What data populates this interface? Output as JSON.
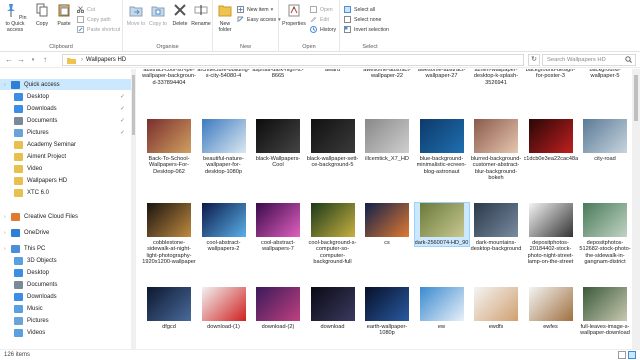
{
  "ribbon": {
    "clipboard": {
      "label": "Clipboard",
      "pin": "Pin to Quick access",
      "copy": "Copy",
      "paste": "Paste",
      "cut": "Cut",
      "copy_path": "Copy path",
      "paste_shortcut": "Paste shortcut"
    },
    "organise": {
      "label": "Organise",
      "move_to": "Move to",
      "copy_to": "Copy to",
      "delete": "Delete",
      "rename": "Rename"
    },
    "new": {
      "label": "New",
      "new_folder": "New folder",
      "new_item": "New item",
      "easy_access": "Easy access"
    },
    "open": {
      "label": "Open",
      "properties": "Properties",
      "open": "Open",
      "edit": "Edit",
      "history": "History"
    },
    "select": {
      "label": "Select",
      "select_all": "Select all",
      "select_none": "Select none",
      "invert": "Invert selection"
    }
  },
  "address": {
    "path_root_sep": "›",
    "folder": "Wallpapers HD",
    "search_placeholder": "Search Wallpapers HD"
  },
  "nav": [
    {
      "label": "Quick access",
      "icon": "star-icon",
      "color": "#2f7fd6"
    },
    {
      "label": "Desktop",
      "icon": "desktop-icon",
      "color": "#3a8ee6",
      "pinned": true
    },
    {
      "label": "Downloads",
      "icon": "download-icon",
      "color": "#3a8ee6",
      "pinned": true
    },
    {
      "label": "Documents",
      "icon": "documents-icon",
      "color": "#7a8a99",
      "pinned": true
    },
    {
      "label": "Pictures",
      "icon": "pictures-icon",
      "color": "#6aa3d8",
      "pinned": true
    },
    {
      "label": "Academy Seminar",
      "icon": "folder-icon",
      "color": "#e8c04d"
    },
    {
      "label": "Aiment Project",
      "icon": "folder-icon",
      "color": "#e8c04d"
    },
    {
      "label": "Video",
      "icon": "folder-icon",
      "color": "#e8c04d"
    },
    {
      "label": "Wallpapers HD",
      "icon": "folder-icon",
      "color": "#e8c04d"
    },
    {
      "label": "XTC 6.0",
      "icon": "folder-icon",
      "color": "#e8c04d"
    },
    {
      "label": "Creative Cloud Files",
      "icon": "cloud-icon",
      "color": "#e07a2e"
    },
    {
      "label": "OneDrive",
      "icon": "onedrive-icon",
      "color": "#2d7fd3"
    },
    {
      "label": "This PC",
      "icon": "computer-icon",
      "color": "#4a90d9"
    },
    {
      "label": "3D Objects",
      "icon": "cube-icon",
      "color": "#5aa0e0"
    },
    {
      "label": "Desktop",
      "icon": "desktop-icon",
      "color": "#3a8ee6"
    },
    {
      "label": "Documents",
      "icon": "documents-icon",
      "color": "#7a8a99"
    },
    {
      "label": "Downloads",
      "icon": "download-icon",
      "color": "#3a8ee6"
    },
    {
      "label": "Music",
      "icon": "music-icon",
      "color": "#5a9fe0"
    },
    {
      "label": "Pictures",
      "icon": "pictures-icon",
      "color": "#6aa3d8"
    },
    {
      "label": "Videos",
      "icon": "video-icon",
      "color": "#5a9fe0"
    }
  ],
  "rows": [
    [
      {
        "name": "abstract-cool-str-ipe-wallpaper-backgroun-d-337894404",
        "colors": [
          "#2a3a52",
          "#6a7fa0"
        ]
      },
      {
        "name": "architecture-building-s-city-54080-4",
        "colors": [
          "#c9c2b0",
          "#6b7a88"
        ]
      },
      {
        "name": "asphalt-dark-high-tc-8665",
        "colors": [
          "#333",
          "#777"
        ]
      },
      {
        "name": "award",
        "colors": [
          "#1d2a40",
          "#c99a2e"
        ]
      },
      {
        "name": "awesome-abstract-wallpaper-22",
        "colors": [
          "#3a1a4a",
          "#d04f7a"
        ]
      },
      {
        "name": "awesome-abstract-wallpaper-27",
        "colors": [
          "#1a2f4e",
          "#4fa3d9"
        ]
      },
      {
        "name": "aznen-wallpaper-desktop-k-splash-3526941",
        "colors": [
          "#5c7a6a",
          "#b8c8a8"
        ]
      },
      {
        "name": "background-design-for-poster-3",
        "colors": [
          "#e4b48a",
          "#7a4f8a"
        ]
      },
      {
        "name": "background-wallpaper-5",
        "colors": [
          "#7aa6c8",
          "#e0e8ef"
        ]
      }
    ],
    [
      {
        "name": "Back-To-School-Wallpapers-For-Desktop-062",
        "colors": [
          "#7a2e2e",
          "#d0a060"
        ]
      },
      {
        "name": "beautiful-nature-wallpaper-for-desktop-1080p",
        "colors": [
          "#3c7ac0",
          "#dbe8f0"
        ]
      },
      {
        "name": "black-Wallpapers-Cool",
        "colors": [
          "#0c0c0c",
          "#444"
        ]
      },
      {
        "name": "black-wallpaper-sett-ce-background-5",
        "colors": [
          "#111",
          "#3a3a3a"
        ]
      },
      {
        "name": "illcemtick_X7_HD",
        "colors": [
          "#888",
          "#cfcfcf"
        ]
      },
      {
        "name": "blue-background-minimalistic-ecreen-blog-astronaut",
        "colors": [
          "#0d3a6a",
          "#1f6fb0"
        ]
      },
      {
        "name": "blurred-background-customer-abstract-blur-background-bokeh",
        "colors": [
          "#8a5a4a",
          "#e6c7b0"
        ]
      },
      {
        "name": "c1dcb0e3ea22cac48a5bb8f1c6ab2",
        "colors": [
          "#2a0606",
          "#c02020"
        ]
      },
      {
        "name": "city-road",
        "colors": [
          "#5a7a98",
          "#c8d4dc"
        ]
      }
    ],
    [
      {
        "name": "cobblestone-sidewalk-at-night-light-photography-1920x1200-wallpaper",
        "colors": [
          "#1a1410",
          "#c08a40"
        ]
      },
      {
        "name": "cool-abstract-wallpapers-2",
        "colors": [
          "#0a1a4a",
          "#5ab0e8"
        ]
      },
      {
        "name": "cool-abstract-wallpapers-7",
        "colors": [
          "#3a0a4a",
          "#e060c0"
        ]
      },
      {
        "name": "cool-background-s-computer-so-computer-background-full",
        "colors": [
          "#1a3a1a",
          "#c8b040"
        ]
      },
      {
        "name": "cs",
        "colors": [
          "#10204a",
          "#e07a30"
        ]
      },
      {
        "name": "dark-2560074-HD_90",
        "colors": [
          "#6a7a3a",
          "#c8c890"
        ],
        "selected": true
      },
      {
        "name": "dark-mountains-desktop-background",
        "colors": [
          "#2a3a4a",
          "#7a8aa0"
        ]
      },
      {
        "name": "depositphotos-20184402-stock-photo-night-street-lamp-on-the-street",
        "colors": [
          "#f4f4f4",
          "#333"
        ]
      },
      {
        "name": "depositphotos-512682-stock-photo-the-sidewalk-in-gangnam-district",
        "colors": [
          "#4a7a58",
          "#c0d4c4"
        ]
      }
    ],
    [
      {
        "name": "dfgcd",
        "colors": [
          "#0c1830",
          "#4a6a9a"
        ]
      },
      {
        "name": "download-(1)",
        "colors": [
          "#f2f2f2",
          "#d02020"
        ]
      },
      {
        "name": "download-(2)",
        "colors": [
          "#3a1a5a",
          "#c04080"
        ]
      },
      {
        "name": "download",
        "colors": [
          "#0a0a14",
          "#3a3a60"
        ]
      },
      {
        "name": "earth-wallpaper-1080p",
        "colors": [
          "#06102a",
          "#2a5aa0"
        ]
      },
      {
        "name": "ew",
        "colors": [
          "#3a8ad0",
          "#e8f0f8"
        ]
      },
      {
        "name": "ewdfs",
        "colors": [
          "#f4f4f4",
          "#d0a070"
        ]
      },
      {
        "name": "ewfes",
        "colors": [
          "#f4f4f4",
          "#a07040"
        ]
      },
      {
        "name": "full-leaves-image-s-wallpaper-download",
        "colors": [
          "#3a5a3a",
          "#c8c8b0"
        ]
      }
    ]
  ],
  "status": {
    "count": "126 items"
  }
}
